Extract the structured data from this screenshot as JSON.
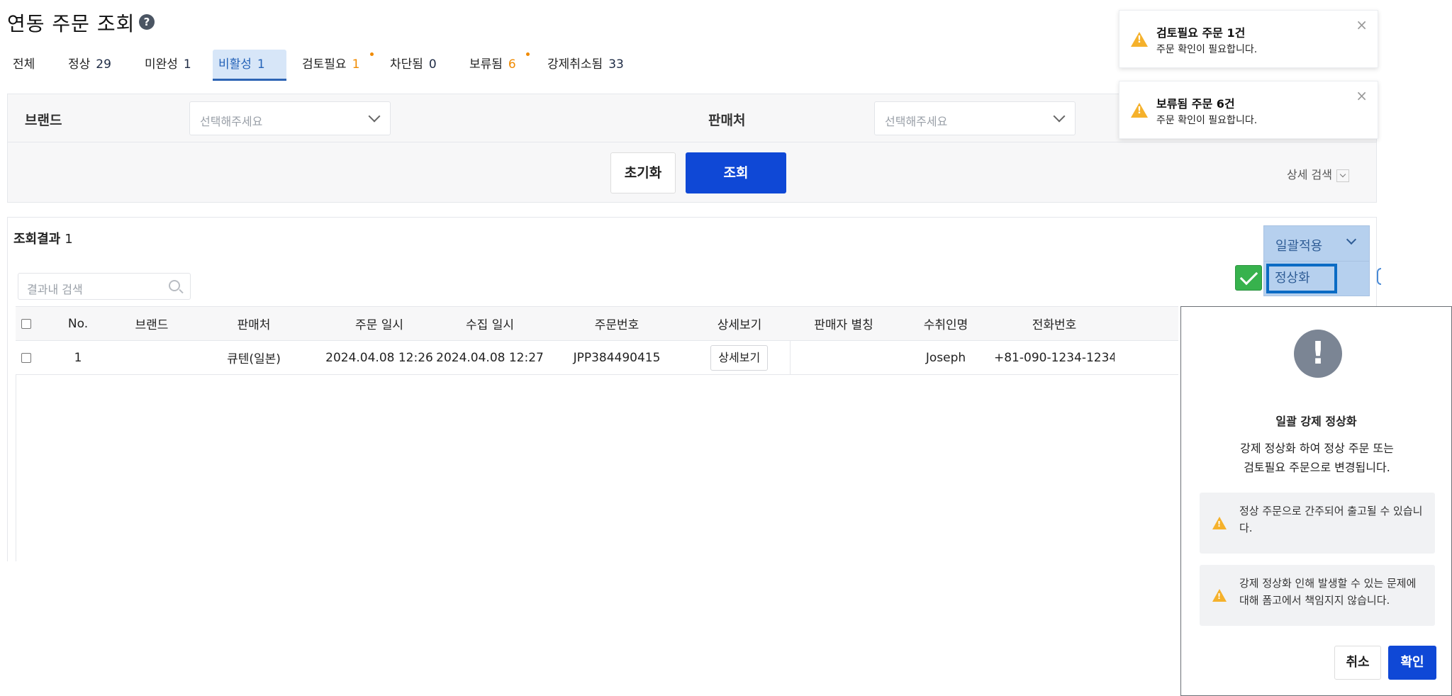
{
  "header": {
    "title": "연동 주문 조회",
    "help_icon": "?"
  },
  "tabs": [
    {
      "label": "전체",
      "count": ""
    },
    {
      "label": "정상",
      "count": "29"
    },
    {
      "label": "미완성",
      "count": "1"
    },
    {
      "label": "비활성",
      "count": "1",
      "active": true
    },
    {
      "label": "검토필요",
      "count": "1",
      "highlight": "orange",
      "dot": true
    },
    {
      "label": "차단됨",
      "count": "0"
    },
    {
      "label": "보류됨",
      "count": "6",
      "highlight": "orange",
      "dot": true
    },
    {
      "label": "강제취소됨",
      "count": "33"
    }
  ],
  "filters": {
    "brand_label": "브랜드",
    "brand_placeholder": "선택해주세요",
    "seller_label": "판매처",
    "seller_placeholder": "선택해주세요",
    "reset_label": "초기화",
    "search_label": "조회",
    "advanced_label": "상세 검색"
  },
  "results": {
    "title": "조회결과",
    "count": "1",
    "search_placeholder": "결과내 검색",
    "bulk_apply_label": "일괄적용",
    "bulk_option": "정상화",
    "columns": [
      "No.",
      "브랜드",
      "판매처",
      "주문 일시",
      "수집 일시",
      "주문번호",
      "상세보기",
      "판매자 별칭",
      "수취인명",
      "전화번호"
    ],
    "rows": [
      {
        "no": "1",
        "brand": "",
        "seller": "큐텐(일본)",
        "order_date": "2024.04.08 12:26",
        "collect_date": "2024.04.08 12:27",
        "order_no": "JPP384490415",
        "detail": "상세보기",
        "alias": "",
        "recipient": "Joseph",
        "phone": "+81-090-1234-1234"
      }
    ]
  },
  "toasts": [
    {
      "title": "검토필요 주문 1건",
      "message": "주문 확인이 필요합니다.",
      "close": "×"
    },
    {
      "title": "보류됨 주문 6건",
      "message": "주문 확인이 필요합니다.",
      "close": "×"
    }
  ],
  "modal": {
    "icon": "!",
    "title": "일괄 강제 정상화",
    "desc_line1": "강제 정상화 하여 정상 주문 또는",
    "desc_line2": "검토필요 주문으로 변경됩니다.",
    "note1": "정상 주문으로 간주되어 출고될 수 있습니다.",
    "note2": "강제 정상화 인해 발생할 수 있는 문제에 대해 폼고에서 책임지지 않습니다.",
    "cancel_label": "취소",
    "confirm_label": "확인"
  },
  "colors": {
    "primary": "#0f48d6",
    "warning": "#f5b12b",
    "active_tab_bg": "#d7e6f8",
    "orange": "#f08a00"
  }
}
